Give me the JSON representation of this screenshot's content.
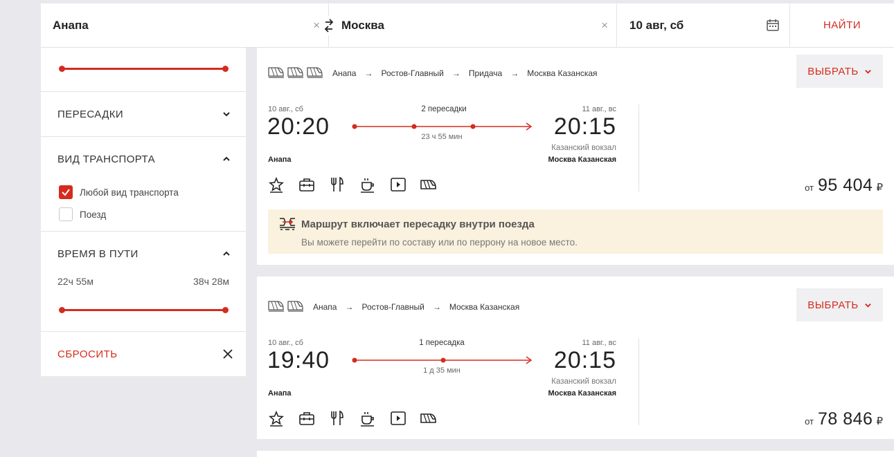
{
  "search": {
    "from": "Анапа",
    "to": "Москва",
    "date": "10 авг, сб",
    "clear_symbol": "×",
    "find_label": "НАЙТИ"
  },
  "filters": {
    "transfers_title": "ПЕРЕСАДКИ",
    "transport_title": "ВИД ТРАНСПОРТА",
    "transport_options": [
      {
        "label": "Любой вид транспорта",
        "checked": true
      },
      {
        "label": "Поезд",
        "checked": false
      }
    ],
    "travel_time_title": "ВРЕМЯ В ПУТИ",
    "travel_time_min": "22ч 55м",
    "travel_time_max": "38ч 28м",
    "reset_label": "СБРОСИТЬ"
  },
  "results": [
    {
      "route": [
        "Анапа",
        "Ростов-Главный",
        "Придача",
        "Москва Казанская"
      ],
      "choose_label": "ВЫБРАТЬ",
      "dep_date": "10 авг., сб",
      "dep_time": "20:20",
      "dep_station": "Анапа",
      "transfers": "2 пересадки",
      "duration": "23 ч 55 мин",
      "arr_date": "11 авг., вс",
      "arr_time": "20:15",
      "arr_station_sub": "Казанский вокзал",
      "arr_station": "Москва Казанская",
      "price_from": "от",
      "price": "95 404",
      "currency": "₽",
      "notice_title": "Маршрут включает пересадку внутри поезда",
      "notice_text": "Вы можете перейти по составу или по перрону на новое место."
    },
    {
      "route": [
        "Анапа",
        "Ростов-Главный",
        "Москва Казанская"
      ],
      "choose_label": "ВЫБРАТЬ",
      "dep_date": "10 авг., сб",
      "dep_time": "19:40",
      "dep_station": "Анапа",
      "transfers": "1 пересадка",
      "duration": "1 д 35 мин",
      "arr_date": "11 авг., вс",
      "arr_time": "20:15",
      "arr_station_sub": "Казанский вокзал",
      "arr_station": "Москва Казанская",
      "price_from": "от",
      "price": "78 846",
      "currency": "₽"
    }
  ],
  "icons": [
    "swap-icon",
    "calendar-icon",
    "chevron-up-icon",
    "chevron-down-icon",
    "close-icon",
    "train-icon",
    "star-icon",
    "luggage-icon",
    "restaurant-icon",
    "coffee-icon",
    "video-icon",
    "transfer-in-train-icon"
  ],
  "colors": {
    "accent": "#d52b1e",
    "notice_bg": "#faf1de",
    "page_bg": "#e9e9ed"
  }
}
